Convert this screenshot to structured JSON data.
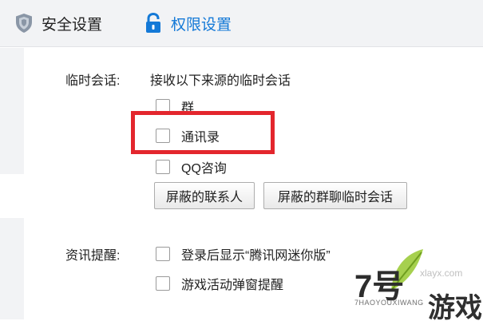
{
  "tabs": [
    {
      "label": "安全设置",
      "icon": "shield-icon"
    },
    {
      "label": "权限设置",
      "icon": "lock-icon"
    }
  ],
  "temp_session": {
    "label": "临时会话:",
    "description": "接收以下来源的临时会话",
    "options": [
      {
        "label": "群",
        "checked": false
      },
      {
        "label": "通讯录",
        "checked": false
      },
      {
        "label": "QQ咨询",
        "checked": false
      }
    ],
    "buttons": {
      "blocked_contacts": "屏蔽的联系人",
      "blocked_group_chats": "屏蔽的群聊临时会话"
    }
  },
  "news_reminder": {
    "label": "资讯提醒:",
    "options": [
      {
        "label": "登录后显示“腾讯网迷你版”",
        "checked": false
      },
      {
        "label": "游戏活动弹窗提醒",
        "checked": false
      }
    ]
  },
  "watermark": {
    "number": "7号",
    "url": "xlayx.com",
    "subtitle": "7HAOYOUXIWANG",
    "text": "游戏"
  },
  "colors": {
    "accent": "#1479d7",
    "highlight": "#e3262d",
    "tabbar_bg": "#f2f3f5"
  }
}
